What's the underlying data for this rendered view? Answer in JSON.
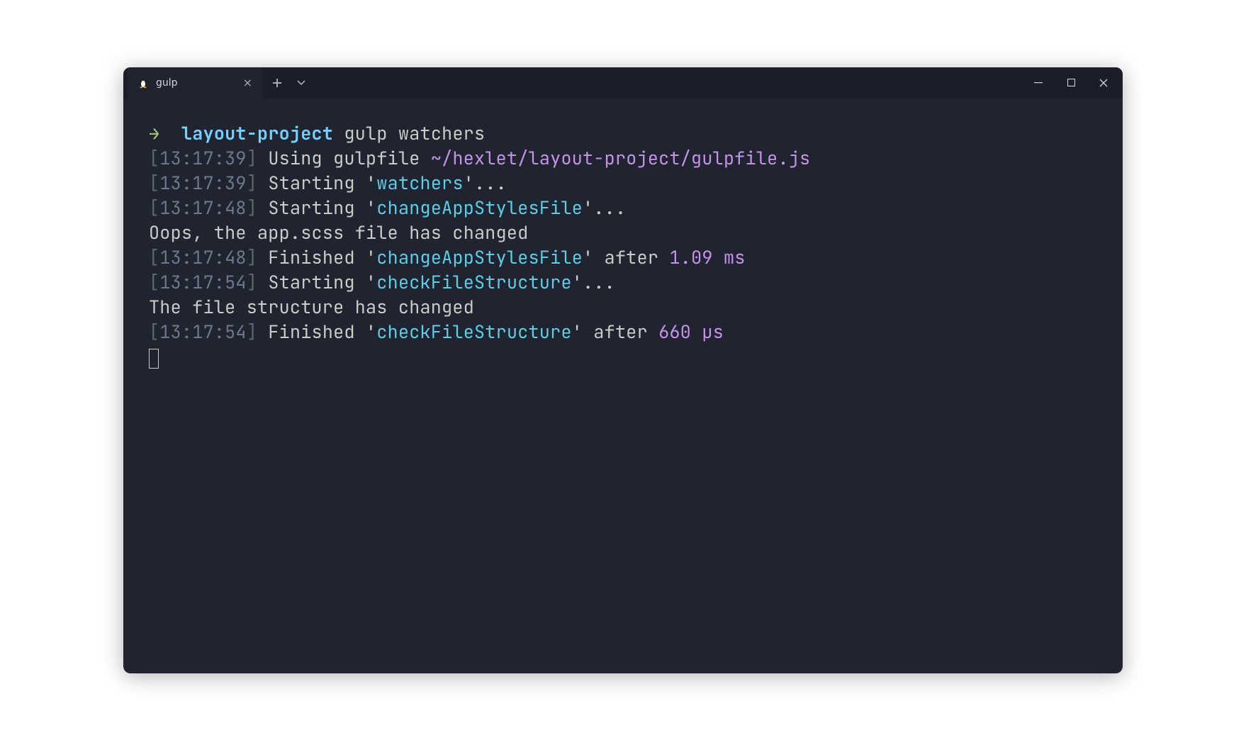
{
  "window": {
    "tab_title": "gulp"
  },
  "prompt": {
    "arrow": "→",
    "cwd": "layout-project",
    "command": "gulp watchers"
  },
  "lines": [
    {
      "ts": "13:17:39",
      "verb": "Using gulpfile",
      "task": "",
      "path": "~/hexlet/layout-project/gulpfile.js",
      "after": "",
      "num": ""
    },
    {
      "ts": "13:17:39",
      "verb": "Starting",
      "task": "watchers",
      "path": "",
      "after": "",
      "num": "",
      "dots": "..."
    },
    {
      "ts": "13:17:48",
      "verb": "Starting",
      "task": "changeAppStylesFile",
      "path": "",
      "after": "",
      "num": "",
      "dots": "..."
    },
    {
      "plain": "Oops, the app.scss file has changed"
    },
    {
      "ts": "13:17:48",
      "verb": "Finished",
      "task": "changeAppStylesFile",
      "path": "",
      "after": " after ",
      "num": "1.09 ms"
    },
    {
      "ts": "13:17:54",
      "verb": "Starting",
      "task": "checkFileStructure",
      "path": "",
      "after": "",
      "num": "",
      "dots": "..."
    },
    {
      "plain": "The file structure has changed"
    },
    {
      "ts": "13:17:54",
      "verb": "Finished",
      "task": "checkFileStructure",
      "path": "",
      "after": " after ",
      "num": "660 μs"
    }
  ]
}
